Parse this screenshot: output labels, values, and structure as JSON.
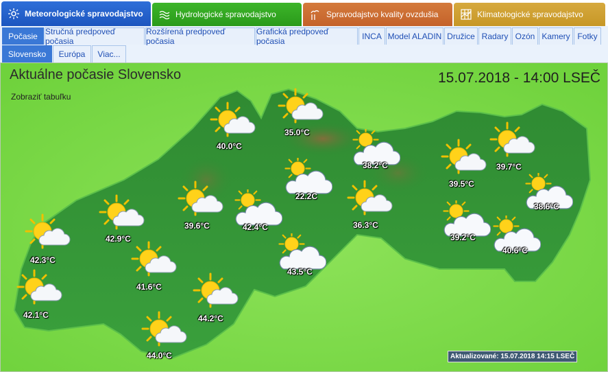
{
  "top_tabs": [
    {
      "label": "Meteorologické spravodajstvo",
      "icon": "sun-icon",
      "color": "#1f5bc4"
    },
    {
      "label": "Hydrologické spravodajstvo",
      "icon": "waves-icon",
      "color": "#33a823"
    },
    {
      "label": "Spravodajstvo kvality ovzdušia",
      "icon": "factory-icon",
      "color": "#cc6d33"
    },
    {
      "label": "Klimatologické spravodajstvo",
      "icon": "chart-icon",
      "color": "#cfa032"
    }
  ],
  "sub_tabs": [
    "Počasie",
    "Stručná predpoveď počasia",
    "Rozšírená predpoveď počasia",
    "Grafická predpoveď počasia",
    "INCA",
    "Model ALADIN",
    "Družice",
    "Radary",
    "Ozón",
    "Kamery",
    "Fotky"
  ],
  "region_tabs": [
    "Slovensko",
    "Európa",
    "Viac..."
  ],
  "map": {
    "title": "Aktuálne počasie Slovensko",
    "datetime": "15.07.2018 - 14:00 LSEČ",
    "toggle_label": "Zobraziť tabuľku",
    "updated": "Aktualizované: 15.07.2018 14:15 LSEČ"
  },
  "stations": [
    {
      "temp": "40.0°C",
      "icon": "partly-cloudy-icon"
    },
    {
      "temp": "35.0°C",
      "icon": "partly-cloudy-icon"
    },
    {
      "temp": "38.2°C",
      "icon": "mostly-cloudy-icon"
    },
    {
      "temp": "39.5°C",
      "icon": "partly-cloudy-icon"
    },
    {
      "temp": "39.7°C",
      "icon": "partly-cloudy-icon"
    },
    {
      "temp": "22.2C",
      "icon": "mostly-cloudy-icon"
    },
    {
      "temp": "38.6°C",
      "icon": "mostly-cloudy-icon"
    },
    {
      "temp": "39.6°C",
      "icon": "partly-cloudy-icon"
    },
    {
      "temp": "42.4°C",
      "icon": "mostly-cloudy-icon"
    },
    {
      "temp": "36.3°C",
      "icon": "partly-cloudy-icon"
    },
    {
      "temp": "42.9°C",
      "icon": "partly-cloudy-icon"
    },
    {
      "temp": "39.2°C",
      "icon": "mostly-cloudy-icon"
    },
    {
      "temp": "40.6°C",
      "icon": "mostly-cloudy-icon"
    },
    {
      "temp": "42.3°C",
      "icon": "partly-cloudy-icon"
    },
    {
      "temp": "41.6°C",
      "icon": "partly-cloudy-icon"
    },
    {
      "temp": "43.5°C",
      "icon": "mostly-cloudy-icon"
    },
    {
      "temp": "42.1°C",
      "icon": "partly-cloudy-icon"
    },
    {
      "temp": "44.2°C",
      "icon": "partly-cloudy-icon"
    },
    {
      "temp": "44.0°C",
      "icon": "partly-cloudy-icon"
    }
  ]
}
